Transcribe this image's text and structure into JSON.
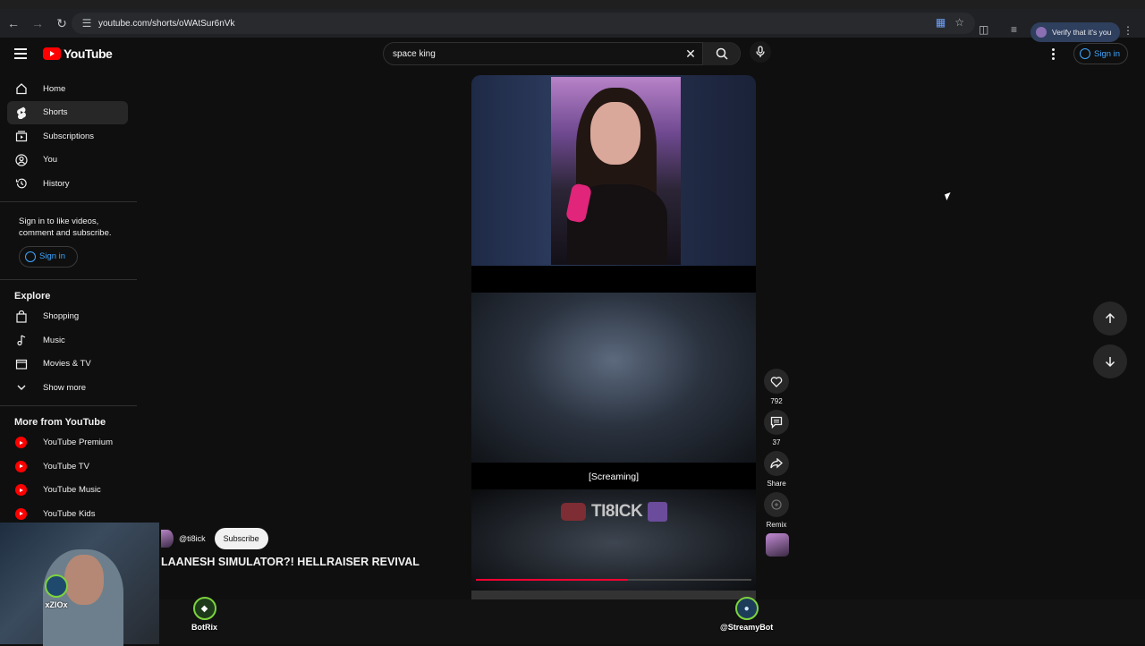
{
  "browser": {
    "url": "youtube.com/shorts/oWAtSur6nVk",
    "verify_label": "Verify that it's you"
  },
  "header": {
    "logo_text": "YouTube",
    "search_value": "space king",
    "sign_in": "Sign in"
  },
  "sidebar": {
    "items": [
      {
        "label": "Home",
        "icon": "home-icon"
      },
      {
        "label": "Shorts",
        "icon": "shorts-icon"
      },
      {
        "label": "Subscriptions",
        "icon": "subscriptions-icon"
      },
      {
        "label": "You",
        "icon": "you-icon"
      },
      {
        "label": "History",
        "icon": "history-icon"
      }
    ],
    "sign_in_message": "Sign in to like videos, comment and subscribe.",
    "sign_in_button": "Sign in",
    "explore_heading": "Explore",
    "explore": [
      {
        "label": "Shopping",
        "icon": "shopping-icon"
      },
      {
        "label": "Music",
        "icon": "music-icon"
      },
      {
        "label": "Movies & TV",
        "icon": "movies-icon"
      },
      {
        "label": "Show more",
        "icon": "chevron-down-icon"
      }
    ],
    "more_heading": "More from YouTube",
    "more": [
      {
        "label": "YouTube Premium"
      },
      {
        "label": "YouTube TV"
      },
      {
        "label": "YouTube Music"
      },
      {
        "label": "YouTube Kids"
      }
    ]
  },
  "video": {
    "subtitle": "[Screaming]",
    "watermark": "TI8ICK",
    "progress": 0.55,
    "channel": "@ti8ick",
    "subscribe": "Subscribe",
    "title": "LAANESH SIMULATOR?! HELLRAISER REVIVAL"
  },
  "actions": {
    "likes": "792",
    "comments": "37",
    "share": "Share",
    "remix": "Remix"
  },
  "overlay": {
    "streamer": "xZIOx",
    "bot1": "BotRix",
    "bot2": "@StreamyBot"
  },
  "colors": {
    "accent_blue": "#3ea6ff",
    "youtube_red": "#ff0000"
  }
}
